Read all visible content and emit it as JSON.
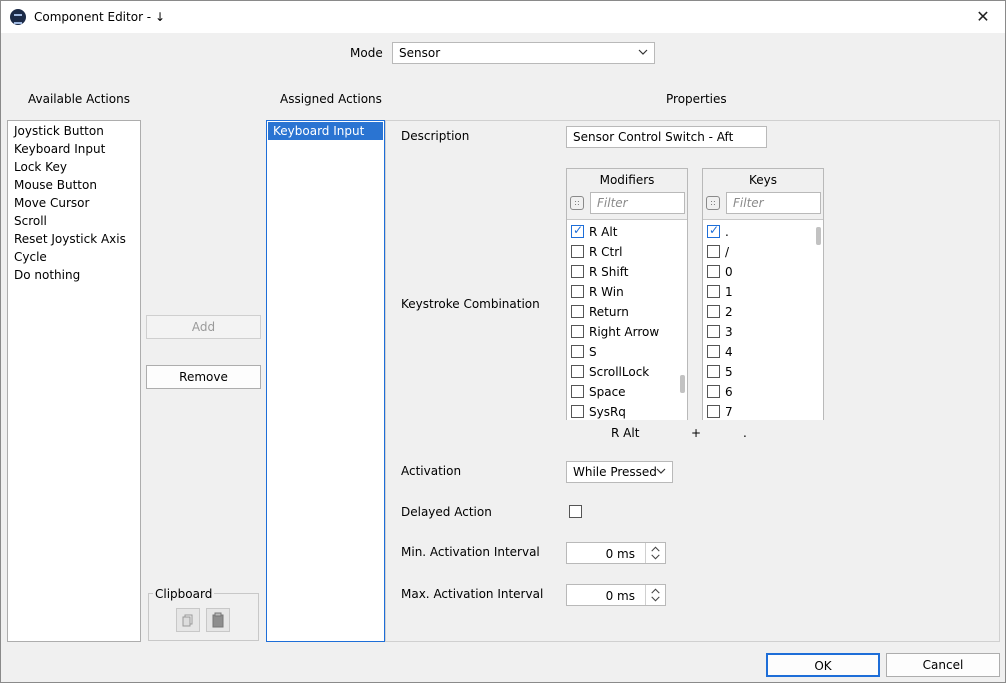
{
  "window": {
    "title": "Component Editor - ↓"
  },
  "mode": {
    "label": "Mode",
    "value": "Sensor"
  },
  "available": {
    "header": "Available Actions",
    "items": [
      "Joystick Button",
      "Keyboard Input",
      "Lock Key",
      "Mouse Button",
      "Move Cursor",
      "Scroll",
      "Reset Joystick Axis",
      "Cycle",
      "Do nothing"
    ]
  },
  "buttons": {
    "add": "Add",
    "remove": "Remove",
    "ok": "OK",
    "cancel": "Cancel"
  },
  "clipboard": {
    "label": "Clipboard"
  },
  "assigned": {
    "header": "Assigned Actions",
    "items": [
      "Keyboard Input"
    ]
  },
  "properties": {
    "header": "Properties",
    "description_label": "Description",
    "description_value": "Sensor Control Switch - Aft",
    "keystroke_label": "Keystroke Combination",
    "modifiers": {
      "header": "Modifiers",
      "filter_placeholder": "Filter",
      "items": [
        {
          "label": "R Alt",
          "checked": true
        },
        {
          "label": "R Ctrl",
          "checked": false
        },
        {
          "label": "R Shift",
          "checked": false
        },
        {
          "label": "R Win",
          "checked": false
        },
        {
          "label": "Return",
          "checked": false
        },
        {
          "label": "Right Arrow",
          "checked": false
        },
        {
          "label": "S",
          "checked": false
        },
        {
          "label": "ScrollLock",
          "checked": false
        },
        {
          "label": "Space",
          "checked": false
        },
        {
          "label": "SysRq",
          "checked": false
        }
      ]
    },
    "keys": {
      "header": "Keys",
      "filter_placeholder": "Filter",
      "items": [
        {
          "label": ".",
          "checked": true
        },
        {
          "label": "/",
          "checked": false
        },
        {
          "label": "0",
          "checked": false
        },
        {
          "label": "1",
          "checked": false
        },
        {
          "label": "2",
          "checked": false
        },
        {
          "label": "3",
          "checked": false
        },
        {
          "label": "4",
          "checked": false
        },
        {
          "label": "5",
          "checked": false
        },
        {
          "label": "6",
          "checked": false
        },
        {
          "label": "7",
          "checked": false
        }
      ]
    },
    "combo_summary": {
      "modifier": "R Alt",
      "plus": "+",
      "key": "."
    },
    "activation_label": "Activation",
    "activation_value": "While Pressed",
    "delayed_label": "Delayed Action",
    "delayed_checked": false,
    "min_label": "Min. Activation Interval",
    "min_value": "0 ms",
    "max_label": "Max. Activation Interval",
    "max_value": "0 ms"
  },
  "colors": {
    "accent": "#1e6ed8",
    "selection": "#2a74d2"
  }
}
